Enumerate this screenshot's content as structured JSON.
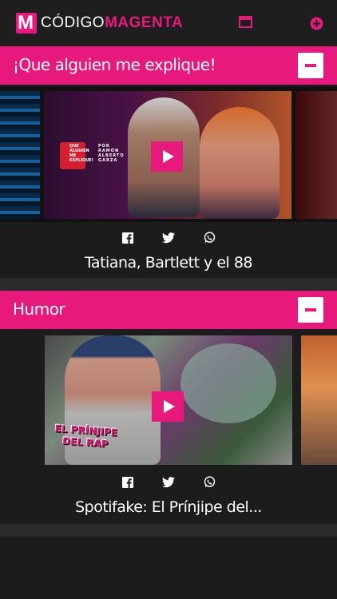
{
  "app": {
    "logo_letter": "M",
    "name_part1": "CÓDIGO",
    "name_part2": "MAGENTA"
  },
  "header_icons": [
    "window-icon",
    "add-circle-icon"
  ],
  "sections": [
    {
      "title": "¡Que alguien me explique!",
      "card": {
        "title": "Tatiana, Bartlett y el 88",
        "thumb_badge": [
          "QUE",
          "ALGUIEN",
          "ME",
          "EXPLIQUE!"
        ],
        "thumb_byline": [
          "POR",
          "RAMÓN",
          "ALBERTO",
          "GARZA"
        ]
      }
    },
    {
      "title": "Humor",
      "card": {
        "title": "Spotifake: El Prínjipe del...",
        "thumb_caption": [
          "EL PRÍNJIPE",
          "DEL RAP"
        ]
      }
    }
  ],
  "share": [
    "facebook-icon",
    "twitter-icon",
    "whatsapp-icon"
  ],
  "colors": {
    "accent": "#e8197d",
    "background": "#1c1c1c"
  }
}
